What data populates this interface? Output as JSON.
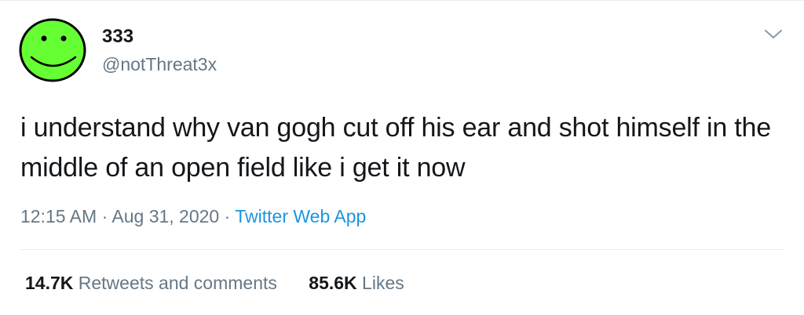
{
  "user": {
    "display_name": "333",
    "handle": "@notThreat3x",
    "avatar_icon": "green-smiley-face-icon",
    "avatar_color": "#66ff33"
  },
  "menu_icon": "chevron-down-icon",
  "tweet": {
    "text": "i understand why van gogh cut off his ear and shot himself in the middle of an open field like i get it now"
  },
  "meta": {
    "time": "12:15 AM",
    "separator": "·",
    "date": "Aug 31, 2020",
    "source": "Twitter Web App"
  },
  "stats": {
    "retweets_count": "14.7K",
    "retweets_label": "Retweets and comments",
    "likes_count": "85.6K",
    "likes_label": "Likes"
  },
  "colors": {
    "text": "#14171a",
    "secondary": "#657786",
    "link": "#1b95e0",
    "divider": "#e6ecf0"
  }
}
